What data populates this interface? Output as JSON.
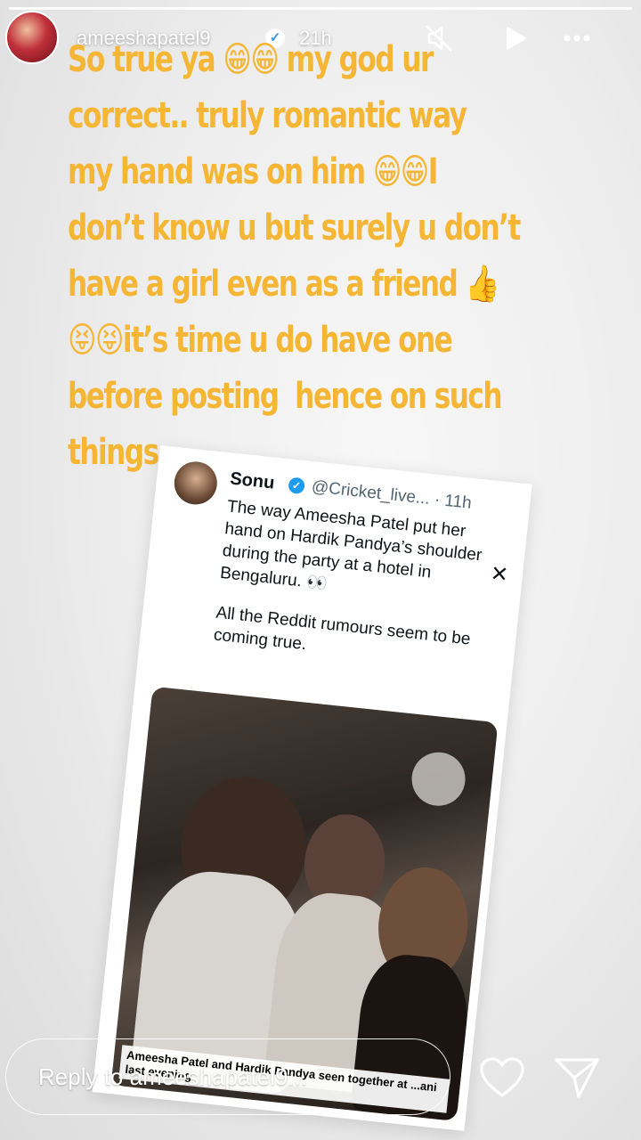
{
  "story": {
    "username": "ameeshapatel9",
    "timestamp": "21h",
    "progress": 1.0,
    "caption_lines": [
      "So true ya 😁😁 my god ur",
      "correct.. truly romantic way",
      "my hand was on him 😁😁I",
      "don’t know u but surely u don’t",
      "have a girl even as a friend 👍",
      "😝😝it’s time u do have one",
      "before posting  hence on such",
      "things .."
    ],
    "caption_color": "#f5b635"
  },
  "header_icons": {
    "mute": "mute-icon",
    "play": "play-icon",
    "more": "more-icon",
    "verified": "verified-badge-icon"
  },
  "tweet": {
    "name": "Sonu",
    "handle": "@Cricket_live... · 11h",
    "body_1": "The way Ameesha Patel put her hand on Hardik Pandya’s shoulder during the party at a hotel in Bengaluru. 👀",
    "body_2": "All the Reddit rumours seem to be coming true.",
    "close_glyph": "✕",
    "media_caption": "Ameesha Patel and Hardik Pandya seen together at ...ani last evening"
  },
  "footer": {
    "reply_placeholder": "Reply to ameeshapatel9...",
    "like_icon": "heart-icon",
    "send_icon": "send-icon"
  }
}
